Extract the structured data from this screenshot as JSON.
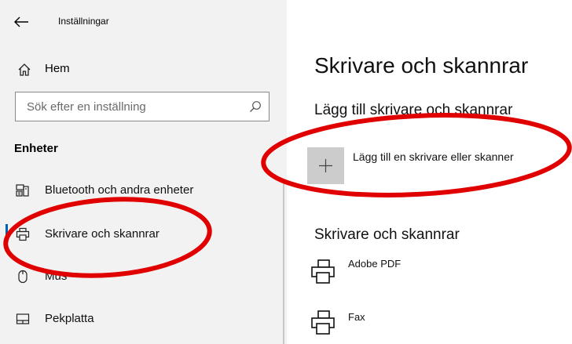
{
  "header": {
    "back_icon": "back-arrow-icon",
    "title": "Inställningar"
  },
  "sidebar": {
    "home_label": "Hem",
    "home_icon": "home-icon",
    "search": {
      "placeholder": "Sök efter en inställning",
      "value": "",
      "icon": "search-icon"
    },
    "section_heading": "Enheter",
    "items": [
      {
        "label": "Bluetooth och andra enheter",
        "icon": "bluetooth-devices-icon",
        "selected": false
      },
      {
        "label": "Skrivare och skannrar",
        "icon": "printer-icon",
        "selected": true
      },
      {
        "label": "Mus",
        "icon": "mouse-icon",
        "selected": false
      },
      {
        "label": "Pekplatta",
        "icon": "touchpad-icon",
        "selected": false
      }
    ]
  },
  "main": {
    "title": "Skrivare och skannrar",
    "add_section_heading": "Lägg till skrivare och skannrar",
    "add_button_label": "Lägg till en skrivare eller skanner",
    "add_icon": "plus-icon",
    "printers_heading": "Skrivare och skannrar",
    "printers": [
      {
        "name": "Adobe PDF",
        "icon": "printer-icon"
      },
      {
        "name": "Fax",
        "icon": "printer-icon"
      }
    ]
  },
  "colors": {
    "sidebar_bg": "#f2f2f2",
    "accent": "#0063b1",
    "annotation_red": "#e00000",
    "add_button_bg": "#cccccc"
  }
}
